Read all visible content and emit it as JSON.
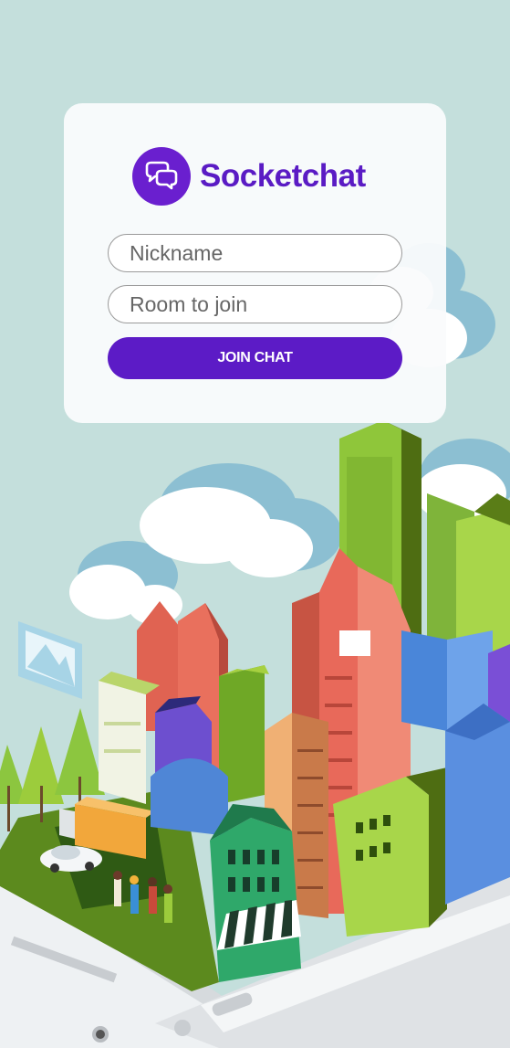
{
  "brand": {
    "name": "Socketchat",
    "logo_icon": "chat-bubbles-icon",
    "accent": "#5c1bc6"
  },
  "form": {
    "nickname_placeholder": "Nickname",
    "room_placeholder": "Room to join",
    "join_label": "JOIN CHAT"
  },
  "background": {
    "illustration": "isometric-city-on-tablet",
    "color": "#c4dfdc"
  }
}
